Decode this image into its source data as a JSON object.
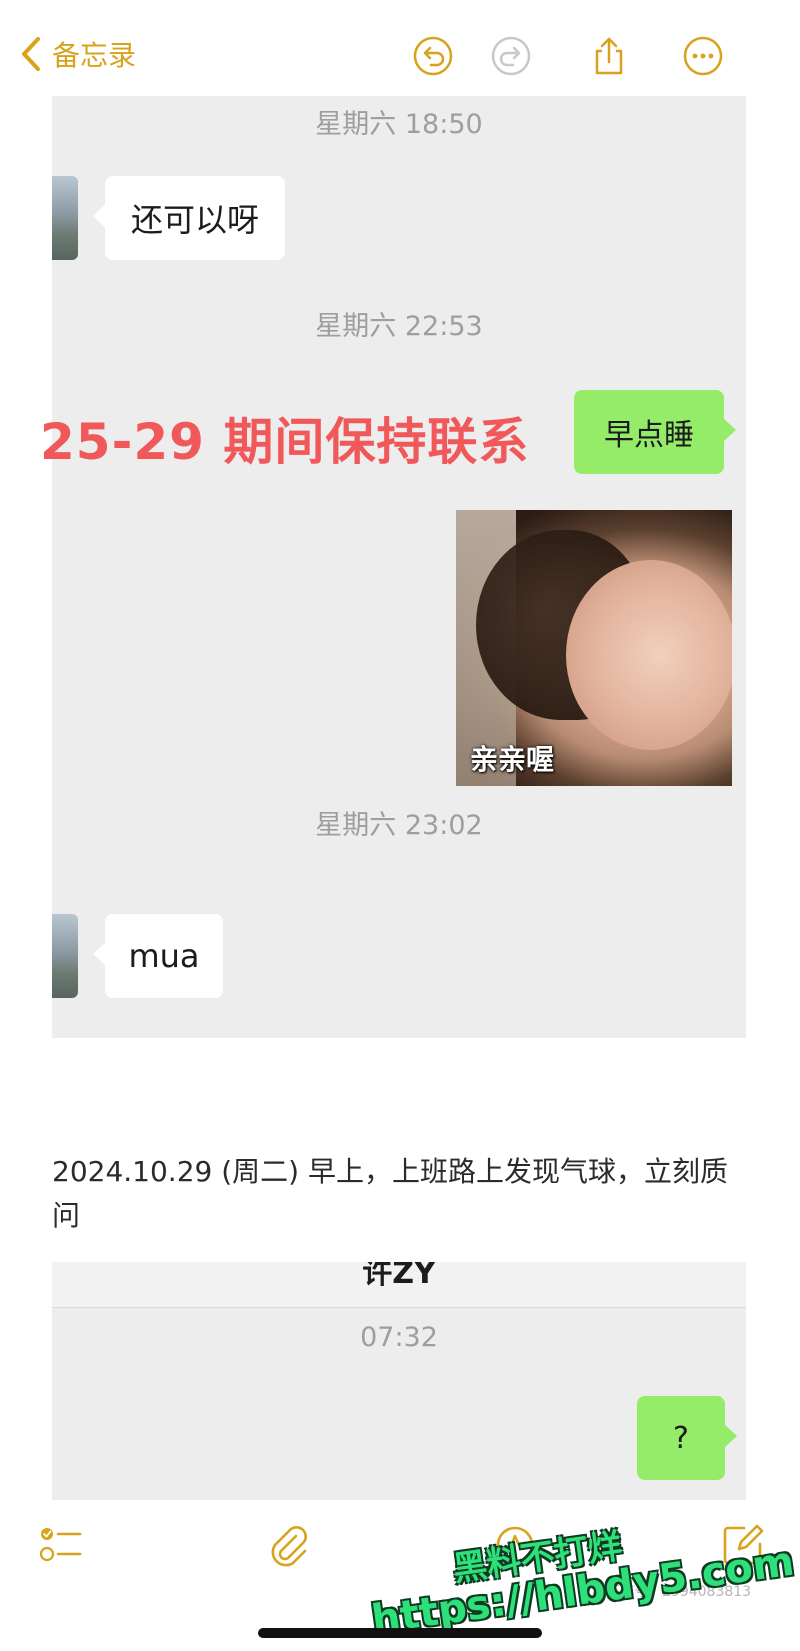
{
  "nav": {
    "back_label": "备忘录",
    "accent_color": "#d8a31a"
  },
  "chat1": {
    "time_1": "星期六 18:50",
    "msg_1": "还可以呀",
    "time_2": "星期六 22:53",
    "msg_2": "早点睡",
    "sticker_caption": "亲亲喔",
    "time_3": "星期六 23:02",
    "msg_3": "mua"
  },
  "overlay_label": "25-29 期间保持联系",
  "note": {
    "body": "2024.10.29 (周二) 早上，上班路上发现气球，立刻质问"
  },
  "chat2": {
    "header_title": "许ZY",
    "time": "07:32",
    "msg": "?"
  },
  "watermark": {
    "site_name": "黑料不打烊",
    "url": "https://hlbdy5.com",
    "source_id": "小红书号：2994083813"
  }
}
